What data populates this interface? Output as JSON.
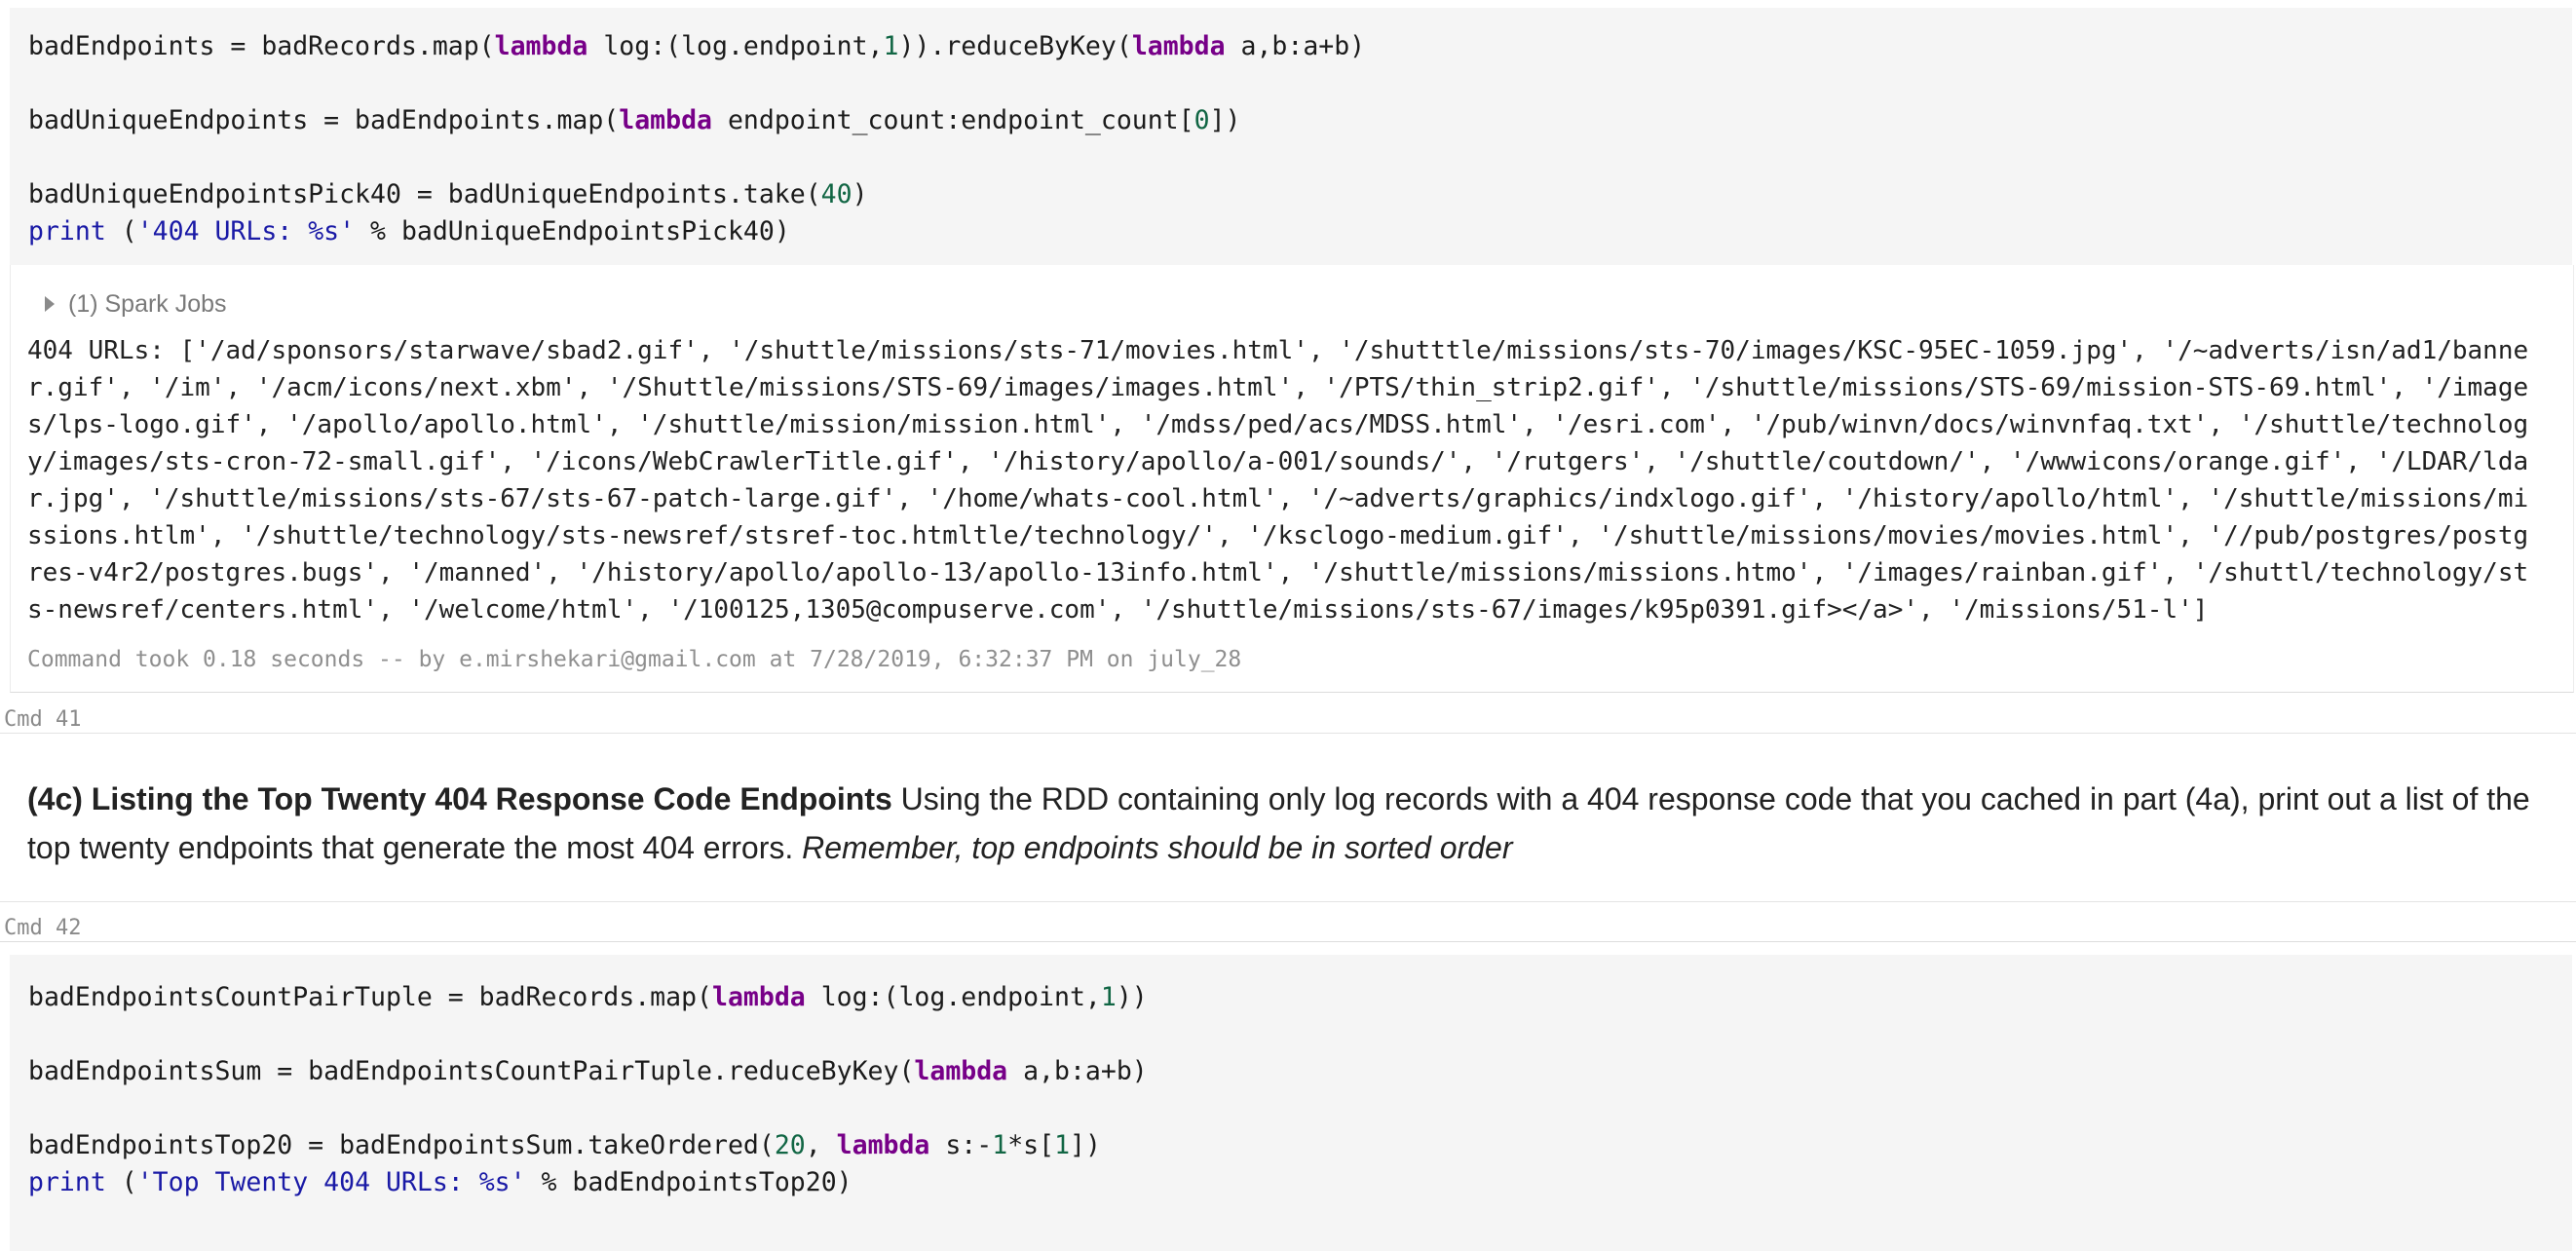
{
  "cell1": {
    "code": {
      "l1_a": "badEndpoints = badRecords.map(",
      "l1_kw1": "lambda",
      "l1_b": " log:(log.endpoint,",
      "l1_n1": "1",
      "l1_c": ")).reduceByKey(",
      "l1_kw2": "lambda",
      "l1_d": " a,b:a+b)",
      "l2_a": "badUniqueEndpoints = badEndpoints.map(",
      "l2_kw": "lambda",
      "l2_b": " endpoint_count:endpoint_count[",
      "l2_n": "0",
      "l2_c": "])",
      "l3_a": "badUniqueEndpointsPick40 = badUniqueEndpoints.take(",
      "l3_n": "40",
      "l3_b": ")",
      "l4_print": "print",
      "l4_a": " (",
      "l4_str": "'404 URLs: %s'",
      "l4_b": " % badUniqueEndpointsPick40)"
    },
    "spark_jobs": "(1) Spark Jobs",
    "output": "404 URLs: ['/ad/sponsors/starwave/sbad2.gif', '/shuttle/missions/sts-71/movies.html', '/shutttle/missions/sts-70/images/KSC-95EC-1059.jpg', '/~adverts/isn/ad1/banner.gif', '/im', '/acm/icons/next.xbm', '/Shuttle/missions/STS-69/images/images.html', '/PTS/thin_strip2.gif', '/shuttle/missions/STS-69/mission-STS-69.html', '/images/lps-logo.gif', '/apollo/apollo.html', '/shuttle/mission/mission.html', '/mdss/ped/acs/MDSS.html', '/esri.com', '/pub/winvn/docs/winvnfaq.txt', '/shuttle/technology/images/sts-cron-72-small.gif', '/icons/WebCrawlerTitle.gif', '/history/apollo/a-001/sounds/', '/rutgers', '/shuttle/coutdown/', '/wwwicons/orange.gif', '/LDAR/ldar.jpg', '/shuttle/missions/sts-67/sts-67-patch-large.gif', '/home/whats-cool.html', '/~adverts/graphics/indxlogo.gif', '/history/apollo/html', '/shuttle/missions/missions.htlm', '/shuttle/technology/sts-newsref/stsref-toc.htmltle/technology/', '/ksclogo-medium.gif', '/shuttle/missions/movies/movies.html', '//pub/postgres/postgres-v4r2/postgres.bugs', '/manned', '/history/apollo/apollo-13/apollo-13info.html', '/shuttle/missions/missions.htmo', '/images/rainban.gif', '/shuttl/technology/sts-newsref/centers.html', '/welcome/html', '/100125,1305@compuserve.com', '/shuttle/missions/sts-67/images/k95p0391.gif></a>', '/missions/51-l']",
    "command_took": "Command took 0.18 seconds -- by e.mirshekari@gmail.com at 7/28/2019, 6:32:37 PM on july_28"
  },
  "cmd41": "Cmd 41",
  "markdown": {
    "heading": "(4c) Listing the Top Twenty 404 Response Code Endpoints",
    "body": " Using the RDD containing only log records with a 404 response code that you cached in part (4a), print out a list of the top twenty endpoints that generate the most 404 errors. ",
    "emphasis": "Remember, top endpoints should be in sorted order"
  },
  "cmd42": "Cmd 42",
  "cell2": {
    "code": {
      "l1_a": "badEndpointsCountPairTuple = badRecords.map(",
      "l1_kw": "lambda",
      "l1_b": " log:(log.endpoint,",
      "l1_n": "1",
      "l1_c": "))",
      "l2_a": "badEndpointsSum = badEndpointsCountPairTuple.reduceByKey(",
      "l2_kw": "lambda",
      "l2_b": " a,b:a+b)",
      "l3_a": "badEndpointsTop20 = badEndpointsSum.takeOrdered(",
      "l3_n1": "20",
      "l3_b": ", ",
      "l3_kw": "lambda",
      "l3_c": " s:-",
      "l3_n2": "1",
      "l3_d": "*s[",
      "l3_n3": "1",
      "l3_e": "])",
      "l4_print": "print",
      "l4_a": " (",
      "l4_str": "'Top Twenty 404 URLs: %s'",
      "l4_b": " % badEndpointsTop20)"
    }
  },
  "colors": {
    "keyword": "#770088",
    "number": "#116644",
    "string": "#1a1aa6",
    "cell_bg": "#f5f5f5",
    "muted": "#8a8a8a"
  }
}
